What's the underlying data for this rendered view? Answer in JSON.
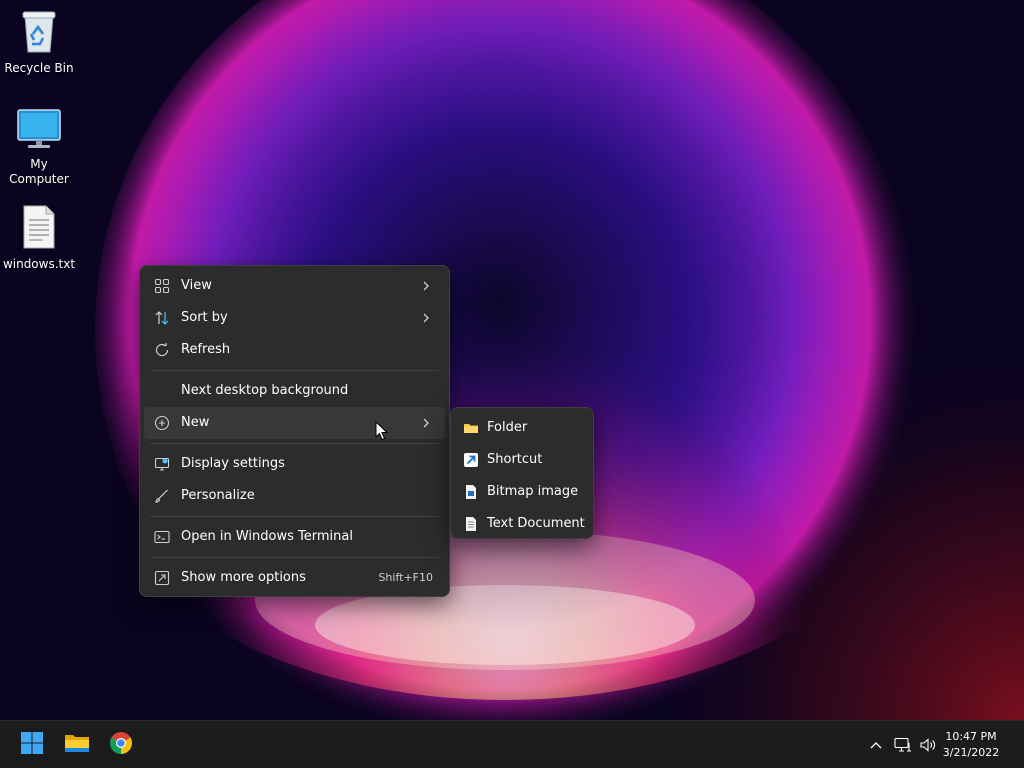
{
  "desktop": {
    "icons": [
      {
        "label": "Recycle Bin",
        "icon": "recycle-bin-icon"
      },
      {
        "label": "My Computer",
        "icon": "monitor-icon"
      },
      {
        "label": "windows.txt",
        "icon": "text-file-icon"
      }
    ]
  },
  "context_menu": {
    "items": [
      {
        "label": "View",
        "icon": "grid-icon",
        "submenu": true
      },
      {
        "label": "Sort by",
        "icon": "sort-icon",
        "submenu": true
      },
      {
        "label": "Refresh",
        "icon": "refresh-icon"
      },
      {
        "label": "Next desktop background",
        "icon": ""
      },
      {
        "label": "New",
        "icon": "plus-circle-icon",
        "submenu": true,
        "highlighted": true
      },
      {
        "label": "Display settings",
        "icon": "display-settings-icon"
      },
      {
        "label": "Personalize",
        "icon": "brush-icon"
      },
      {
        "label": "Open in Windows Terminal",
        "icon": "terminal-icon"
      },
      {
        "label": "Show more options",
        "icon": "more-options-icon",
        "shortcut": "Shift+F10"
      }
    ]
  },
  "new_submenu": {
    "items": [
      {
        "label": "Folder",
        "icon": "folder-icon"
      },
      {
        "label": "Shortcut",
        "icon": "shortcut-arrow-icon"
      },
      {
        "label": "Bitmap image",
        "icon": "bitmap-file-icon"
      },
      {
        "label": "Text Document",
        "icon": "text-document-icon"
      }
    ]
  },
  "taskbar": {
    "pinned": [
      {
        "name": "start-button",
        "icon": "windows-logo-icon"
      },
      {
        "name": "file-explorer-button",
        "icon": "folder-icon"
      },
      {
        "name": "chrome-button",
        "icon": "chrome-icon"
      }
    ],
    "tray": {
      "icons": [
        "chevron-up-icon",
        "network-icon",
        "volume-icon"
      ],
      "time": "10:47 PM",
      "date": "3/21/2022"
    }
  },
  "colors": {
    "menu_bg": "#2c2c2c",
    "menu_hover": "#383838",
    "taskbar_bg": "#1c1c1c",
    "accent": "#0078d4"
  }
}
